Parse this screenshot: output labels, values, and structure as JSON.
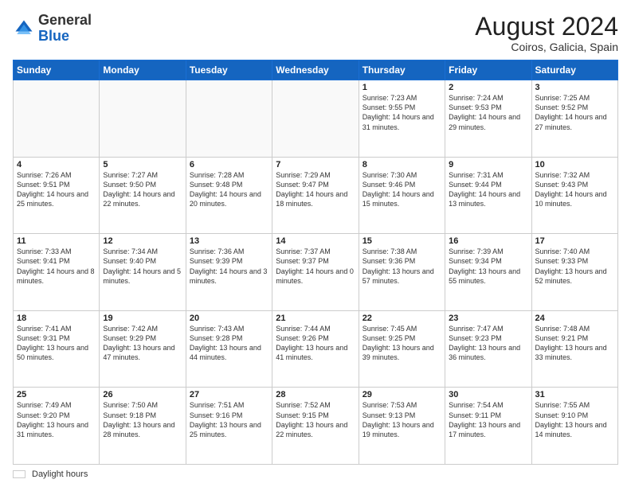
{
  "header": {
    "logo_general": "General",
    "logo_blue": "Blue",
    "month_year": "August 2024",
    "location": "Coiros, Galicia, Spain"
  },
  "footer": {
    "legend_label": "Daylight hours"
  },
  "days_of_week": [
    "Sunday",
    "Monday",
    "Tuesday",
    "Wednesday",
    "Thursday",
    "Friday",
    "Saturday"
  ],
  "weeks": [
    [
      {
        "day": "",
        "info": ""
      },
      {
        "day": "",
        "info": ""
      },
      {
        "day": "",
        "info": ""
      },
      {
        "day": "",
        "info": ""
      },
      {
        "day": "1",
        "info": "Sunrise: 7:23 AM\nSunset: 9:55 PM\nDaylight: 14 hours and 31 minutes."
      },
      {
        "day": "2",
        "info": "Sunrise: 7:24 AM\nSunset: 9:53 PM\nDaylight: 14 hours and 29 minutes."
      },
      {
        "day": "3",
        "info": "Sunrise: 7:25 AM\nSunset: 9:52 PM\nDaylight: 14 hours and 27 minutes."
      }
    ],
    [
      {
        "day": "4",
        "info": "Sunrise: 7:26 AM\nSunset: 9:51 PM\nDaylight: 14 hours and 25 minutes."
      },
      {
        "day": "5",
        "info": "Sunrise: 7:27 AM\nSunset: 9:50 PM\nDaylight: 14 hours and 22 minutes."
      },
      {
        "day": "6",
        "info": "Sunrise: 7:28 AM\nSunset: 9:48 PM\nDaylight: 14 hours and 20 minutes."
      },
      {
        "day": "7",
        "info": "Sunrise: 7:29 AM\nSunset: 9:47 PM\nDaylight: 14 hours and 18 minutes."
      },
      {
        "day": "8",
        "info": "Sunrise: 7:30 AM\nSunset: 9:46 PM\nDaylight: 14 hours and 15 minutes."
      },
      {
        "day": "9",
        "info": "Sunrise: 7:31 AM\nSunset: 9:44 PM\nDaylight: 14 hours and 13 minutes."
      },
      {
        "day": "10",
        "info": "Sunrise: 7:32 AM\nSunset: 9:43 PM\nDaylight: 14 hours and 10 minutes."
      }
    ],
    [
      {
        "day": "11",
        "info": "Sunrise: 7:33 AM\nSunset: 9:41 PM\nDaylight: 14 hours and 8 minutes."
      },
      {
        "day": "12",
        "info": "Sunrise: 7:34 AM\nSunset: 9:40 PM\nDaylight: 14 hours and 5 minutes."
      },
      {
        "day": "13",
        "info": "Sunrise: 7:36 AM\nSunset: 9:39 PM\nDaylight: 14 hours and 3 minutes."
      },
      {
        "day": "14",
        "info": "Sunrise: 7:37 AM\nSunset: 9:37 PM\nDaylight: 14 hours and 0 minutes."
      },
      {
        "day": "15",
        "info": "Sunrise: 7:38 AM\nSunset: 9:36 PM\nDaylight: 13 hours and 57 minutes."
      },
      {
        "day": "16",
        "info": "Sunrise: 7:39 AM\nSunset: 9:34 PM\nDaylight: 13 hours and 55 minutes."
      },
      {
        "day": "17",
        "info": "Sunrise: 7:40 AM\nSunset: 9:33 PM\nDaylight: 13 hours and 52 minutes."
      }
    ],
    [
      {
        "day": "18",
        "info": "Sunrise: 7:41 AM\nSunset: 9:31 PM\nDaylight: 13 hours and 50 minutes."
      },
      {
        "day": "19",
        "info": "Sunrise: 7:42 AM\nSunset: 9:29 PM\nDaylight: 13 hours and 47 minutes."
      },
      {
        "day": "20",
        "info": "Sunrise: 7:43 AM\nSunset: 9:28 PM\nDaylight: 13 hours and 44 minutes."
      },
      {
        "day": "21",
        "info": "Sunrise: 7:44 AM\nSunset: 9:26 PM\nDaylight: 13 hours and 41 minutes."
      },
      {
        "day": "22",
        "info": "Sunrise: 7:45 AM\nSunset: 9:25 PM\nDaylight: 13 hours and 39 minutes."
      },
      {
        "day": "23",
        "info": "Sunrise: 7:47 AM\nSunset: 9:23 PM\nDaylight: 13 hours and 36 minutes."
      },
      {
        "day": "24",
        "info": "Sunrise: 7:48 AM\nSunset: 9:21 PM\nDaylight: 13 hours and 33 minutes."
      }
    ],
    [
      {
        "day": "25",
        "info": "Sunrise: 7:49 AM\nSunset: 9:20 PM\nDaylight: 13 hours and 31 minutes."
      },
      {
        "day": "26",
        "info": "Sunrise: 7:50 AM\nSunset: 9:18 PM\nDaylight: 13 hours and 28 minutes."
      },
      {
        "day": "27",
        "info": "Sunrise: 7:51 AM\nSunset: 9:16 PM\nDaylight: 13 hours and 25 minutes."
      },
      {
        "day": "28",
        "info": "Sunrise: 7:52 AM\nSunset: 9:15 PM\nDaylight: 13 hours and 22 minutes."
      },
      {
        "day": "29",
        "info": "Sunrise: 7:53 AM\nSunset: 9:13 PM\nDaylight: 13 hours and 19 minutes."
      },
      {
        "day": "30",
        "info": "Sunrise: 7:54 AM\nSunset: 9:11 PM\nDaylight: 13 hours and 17 minutes."
      },
      {
        "day": "31",
        "info": "Sunrise: 7:55 AM\nSunset: 9:10 PM\nDaylight: 13 hours and 14 minutes."
      }
    ]
  ]
}
